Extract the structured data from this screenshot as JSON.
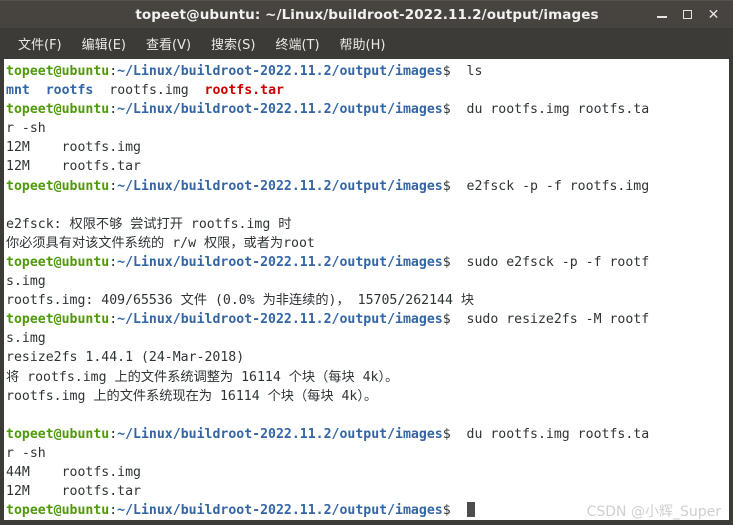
{
  "window": {
    "title": "topeet@ubuntu: ~/Linux/buildroot-2022.11.2/output/images",
    "controls": {
      "minimize": "minimize-icon",
      "maximize": "maximize-icon",
      "close": "close-icon"
    }
  },
  "menubar": {
    "items": [
      {
        "label": "文件(F)"
      },
      {
        "label": "编辑(E)"
      },
      {
        "label": "查看(V)"
      },
      {
        "label": "搜索(S)"
      },
      {
        "label": "终端(T)"
      },
      {
        "label": "帮助(H)"
      }
    ]
  },
  "terminal": {
    "prompt_user": "topeet@ubuntu",
    "prompt_colon": ":",
    "prompt_path": "~/Linux/buildroot-2022.11.2/output/images",
    "prompt_dollar": "$ ",
    "lines": [
      {
        "type": "prompt",
        "command": " ls"
      },
      {
        "type": "ls",
        "entries": [
          {
            "name": "mnt",
            "kind": "dir"
          },
          {
            "name": "rootfs",
            "kind": "dir"
          },
          {
            "name": "rootfs.img",
            "kind": "file"
          },
          {
            "name": "rootfs.tar",
            "kind": "archive"
          }
        ]
      },
      {
        "type": "prompt",
        "command": " du rootfs.img rootfs.ta"
      },
      {
        "type": "output",
        "text": "r -sh"
      },
      {
        "type": "output",
        "text": "12M\trootfs.img"
      },
      {
        "type": "output",
        "text": "12M\trootfs.tar"
      },
      {
        "type": "prompt",
        "command": " e2fsck -p -f rootfs.img"
      },
      {
        "type": "blank"
      },
      {
        "type": "output",
        "text": "e2fsck: 权限不够 尝试打开 rootfs.img 时"
      },
      {
        "type": "output",
        "text": "你必须具有对该文件系统的 r/w 权限，或者为root"
      },
      {
        "type": "prompt",
        "command": " sudo e2fsck -p -f rootf"
      },
      {
        "type": "output",
        "text": "s.img"
      },
      {
        "type": "output",
        "text": "rootfs.img: 409/65536 文件 (0.0% 为非连续的)， 15705/262144 块"
      },
      {
        "type": "prompt",
        "command": " sudo resize2fs -M rootf"
      },
      {
        "type": "output",
        "text": "s.img"
      },
      {
        "type": "output",
        "text": "resize2fs 1.44.1 (24-Mar-2018)"
      },
      {
        "type": "output",
        "text": "将 rootfs.img 上的文件系统调整为 16114 个块（每块 4k）。"
      },
      {
        "type": "output",
        "text": "rootfs.img 上的文件系统现在为 16114 个块（每块 4k）。"
      },
      {
        "type": "blank"
      },
      {
        "type": "prompt",
        "command": " du rootfs.img rootfs.ta"
      },
      {
        "type": "output",
        "text": "r -sh"
      },
      {
        "type": "output",
        "text": "44M\trootfs.img"
      },
      {
        "type": "output",
        "text": "12M\trootfs.tar"
      },
      {
        "type": "prompt_cursor",
        "command": " "
      }
    ]
  },
  "watermark": {
    "text": "CSDN @小辉_Super"
  },
  "colors": {
    "titlebar_bg": "#474440",
    "menubar_bg": "#3c3b37",
    "terminal_bg": "#ffffff",
    "prompt_user": "#4e9a06",
    "prompt_path": "#3465a4",
    "text": "#2e3436",
    "dir": "#3465a4",
    "archive": "#cc0000",
    "cursor": "#4d4d4d"
  }
}
